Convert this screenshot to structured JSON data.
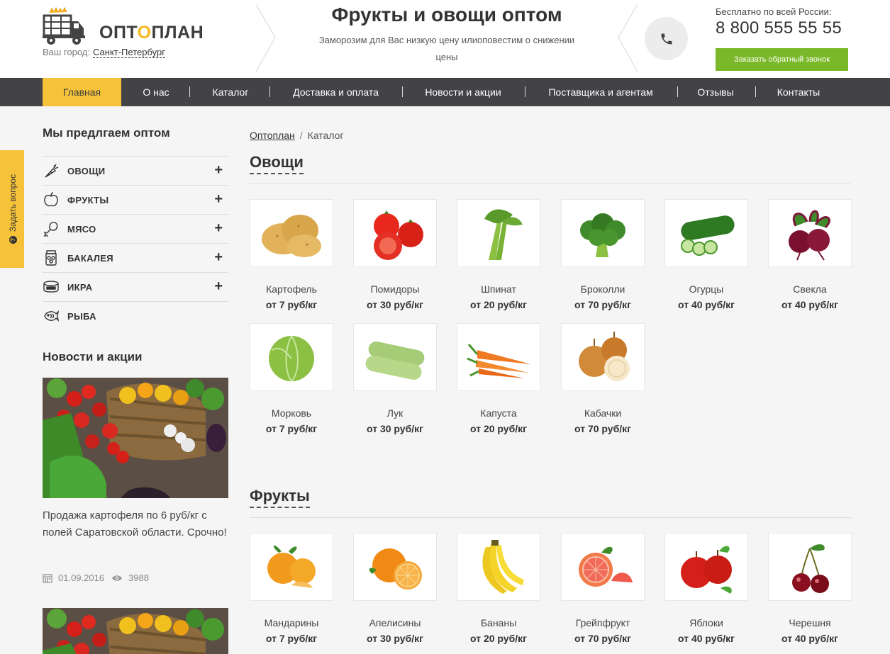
{
  "header": {
    "logo_prefix": "ОПТ",
    "logo_o": "О",
    "logo_suffix": "ПЛАН",
    "city_label": "Ваш город:",
    "city_value": "Санкт-Петербург",
    "promo_title": "Фрукты и овощи оптом",
    "promo_subtitle": "Заморозим для Вас низкую цену илиоповестим о снижении цены",
    "contact_note": "Бесплатно по всей России:",
    "phone": "8 800 555 55 55",
    "callback_label": "Заказать обратный звонок"
  },
  "nav": {
    "items": [
      {
        "label": "Главная"
      },
      {
        "label": "О нас"
      },
      {
        "label": "Каталог"
      },
      {
        "label": "Доставка и оплата"
      },
      {
        "label": "Новости и акции"
      },
      {
        "label": "Поставщика и агентам"
      },
      {
        "label": "Отзывы"
      },
      {
        "label": "Контакты"
      }
    ],
    "separator": "|"
  },
  "side_tab": {
    "label": "Задать вопрос"
  },
  "sidebar": {
    "title": "Мы предлгаем оптом",
    "categories": [
      {
        "label": "ОВОЩИ",
        "icon": "carrot-icon"
      },
      {
        "label": "ФРУКТЫ",
        "icon": "apple-icon"
      },
      {
        "label": "МЯСО",
        "icon": "drumstick-icon"
      },
      {
        "label": "БАКАЛЕЯ",
        "icon": "jar-icon"
      },
      {
        "label": "ИКРА",
        "icon": "caviar-can-icon"
      },
      {
        "label": "РЫБА",
        "icon": "fish-icon"
      }
    ],
    "plus": "+",
    "news_title": "Новости и акции",
    "news_text": "Продажа картофеля по 6 руб/кг с полей Саратовской области. Срочно!",
    "news_date": "01.09.2016",
    "news_views": "3988"
  },
  "breadcrumb": {
    "home": "Оптоплан",
    "sep": "/",
    "current": "Каталог"
  },
  "catalog": {
    "vegetables_title": "Овощи",
    "vegetables": [
      {
        "name": "Картофель",
        "price": "от 7 руб/кг"
      },
      {
        "name": "Помидоры",
        "price": "от 30 руб/кг"
      },
      {
        "name": "Шпинат",
        "price": "от 20 руб/кг"
      },
      {
        "name": "Броколли",
        "price": "от 70 руб/кг"
      },
      {
        "name": "Огурцы",
        "price": "от 40 руб/кг"
      },
      {
        "name": "Свекла",
        "price": "от 40 руб/кг"
      },
      {
        "name": "Морковь",
        "price": "от 7 руб/кг"
      },
      {
        "name": "Лук",
        "price": "от 30 руб/кг"
      },
      {
        "name": "Капуста",
        "price": "от 20 руб/кг"
      },
      {
        "name": "Кабачки",
        "price": "от 70 руб/кг"
      }
    ],
    "fruits_title": "Фрукты",
    "fruits": [
      {
        "name": "Мандарины",
        "price": "от 7 руб/кг"
      },
      {
        "name": "Апелисины",
        "price": "от 30 руб/кг"
      },
      {
        "name": "Бананы",
        "price": "от 20 руб/кг"
      },
      {
        "name": "Грейпфрукт",
        "price": "от 70 руб/кг"
      },
      {
        "name": "Яблоки",
        "price": "от 40 руб/кг"
      },
      {
        "name": "Черешня",
        "price": "от 40 руб/кг"
      }
    ]
  },
  "colors": {
    "accent_yellow": "#f5c23a",
    "nav_bg": "#434347",
    "callback_green": "#7ab82a"
  }
}
